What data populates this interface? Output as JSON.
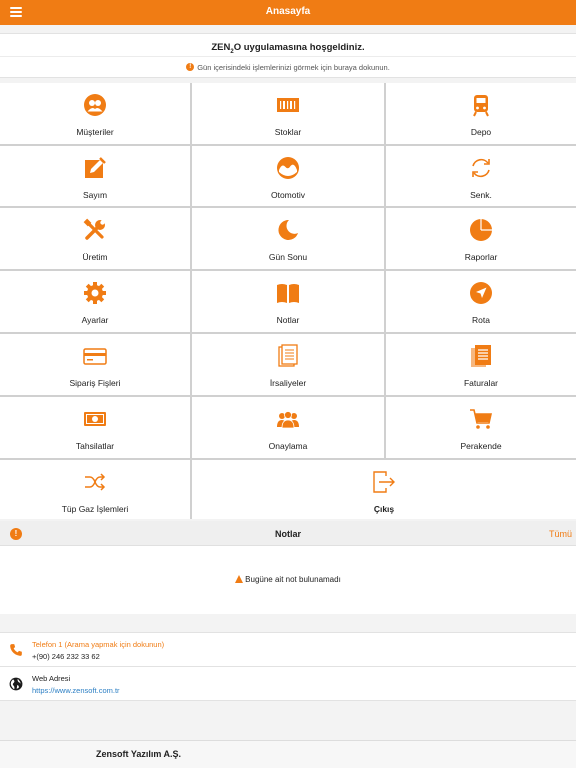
{
  "header": {
    "title": "Anasayfa",
    "menu_icon": "hamburger-menu-icon"
  },
  "welcome": {
    "title_pre": "ZEN",
    "title_sub": "2",
    "title_post": "O uygulamasına hoşgeldiniz.",
    "hint_icon": "info-icon",
    "hint": "Gün içerisindeki işlemlerinizi görmek için buraya dokunun."
  },
  "menu": {
    "items": [
      {
        "label": "Müşteriler",
        "icon": "customers-icon"
      },
      {
        "label": "Stoklar",
        "icon": "barcode-icon"
      },
      {
        "label": "Depo",
        "icon": "train-icon"
      },
      {
        "label": "Sayım",
        "icon": "edit-icon"
      },
      {
        "label": "Otomotiv",
        "icon": "gauge-icon"
      },
      {
        "label": "Senk.",
        "icon": "sync-icon"
      },
      {
        "label": "Üretim",
        "icon": "tools-icon"
      },
      {
        "label": "Gün Sonu",
        "icon": "moon-icon"
      },
      {
        "label": "Raporlar",
        "icon": "pie-chart-icon"
      },
      {
        "label": "Ayarlar",
        "icon": "gear-icon"
      },
      {
        "label": "Notlar",
        "icon": "book-icon"
      },
      {
        "label": "Rota",
        "icon": "navigation-icon"
      },
      {
        "label": "Sipariş Fişleri",
        "icon": "credit-card-icon"
      },
      {
        "label": "İrsaliyeler",
        "icon": "document-icon"
      },
      {
        "label": "Faturalar",
        "icon": "invoice-icon"
      },
      {
        "label": "Tahsilatlar",
        "icon": "cash-icon"
      },
      {
        "label": "Onaylama",
        "icon": "group-icon"
      },
      {
        "label": "Perakende",
        "icon": "cart-icon"
      },
      {
        "label": "Tüp Gaz İşlemleri",
        "icon": "shuffle-icon"
      },
      {
        "label": "Çıkış",
        "icon": "logout-icon"
      }
    ]
  },
  "notes": {
    "badge": "!",
    "title": "Notlar",
    "all_link": "Tümü",
    "empty_icon": "warning-icon",
    "empty": "Bugüne ait not bulunamadı"
  },
  "contacts": [
    {
      "icon": "phone-icon",
      "label": "Telefon 1 (Arama yapmak için dokunun)",
      "value": "+(90) 246 232 33 62"
    },
    {
      "icon": "globe-icon",
      "label": "Web Adresi",
      "value": "https://www.zensoft.com.tr"
    }
  ],
  "footer": {
    "company": "Zensoft Yazılım A.Ş."
  },
  "colors": {
    "accent": "#f07c14",
    "link": "#2c7fc4"
  }
}
